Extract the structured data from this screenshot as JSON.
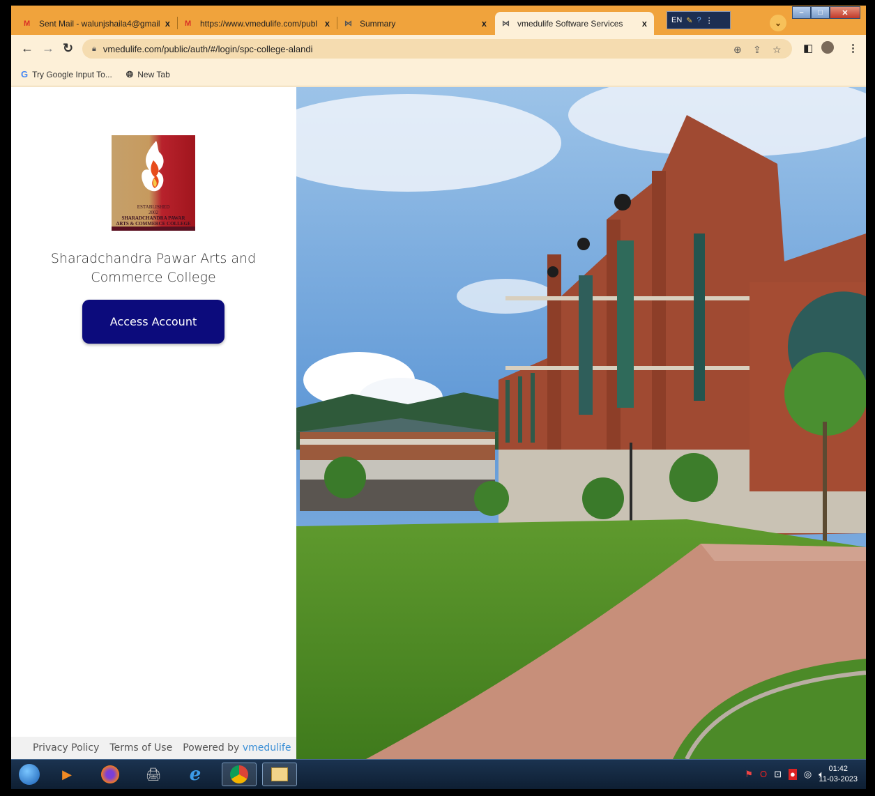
{
  "browser": {
    "tabs": [
      {
        "favicon": "gmail-icon",
        "title": "Sent Mail - walunjshaila4@gmail",
        "active": false
      },
      {
        "favicon": "gmail-icon",
        "title": "https://www.vmedulife.com/publ",
        "active": false
      },
      {
        "favicon": "vmedulife-icon",
        "title": "Summary",
        "active": false
      },
      {
        "favicon": "vmedulife-icon",
        "title": "vmedulife Software Services",
        "active": true
      }
    ],
    "close_glyph": "x",
    "ime_label": "EN",
    "url": "vmedulife.com/public/auth/#/login/spc-college-alandi",
    "bookmarks": [
      {
        "icon": "google-icon",
        "label": "Try Google Input To..."
      },
      {
        "icon": "globe-icon",
        "label": "New Tab"
      }
    ]
  },
  "login": {
    "logo_text": {
      "established": "ESTABLISHED",
      "year": "2002",
      "line1": "SHARADCHANDRA PAWAR",
      "line2": "ARTS & COMMERCE COLLEGE"
    },
    "college_name": "Sharadchandra Pawar Arts and Commerce College",
    "access_button": "Access Account",
    "footer": {
      "privacy": "Privacy Policy",
      "terms": "Terms of Use",
      "powered_by": "Powered by",
      "brand": "vmedulife"
    }
  },
  "taskbar": {
    "apps": [
      "start-orb",
      "media-player-icon",
      "firefox-icon",
      "scanner-icon",
      "internet-explorer-icon",
      "chrome-icon",
      "file-explorer-icon"
    ],
    "clock_time": "01:42",
    "clock_date": "11-03-2023"
  },
  "colors": {
    "tab_strip": "#f0a33c",
    "toolbar": "#fdf0d8",
    "access_button": "#0c0b7c",
    "brand_link": "#3b8fd6"
  }
}
